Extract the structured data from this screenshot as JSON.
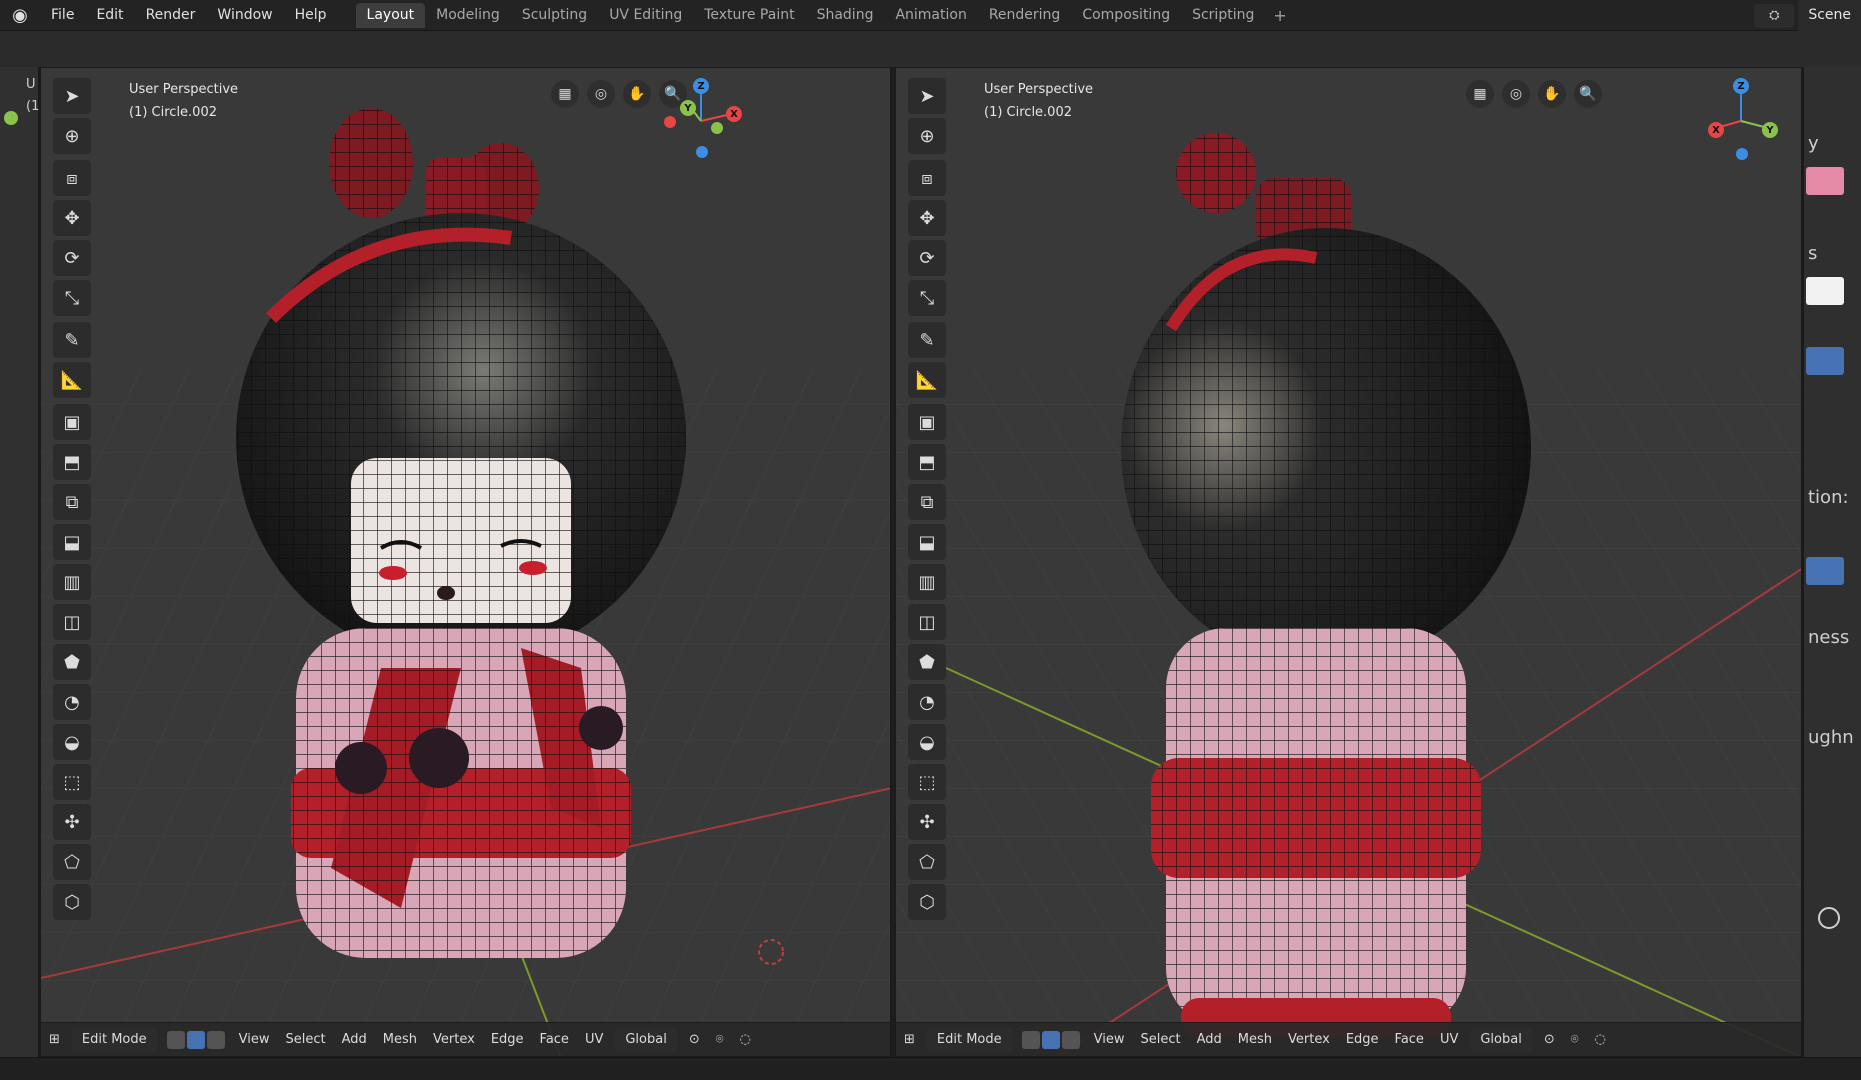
{
  "topbar": {
    "menus": [
      "File",
      "Edit",
      "Render",
      "Window",
      "Help"
    ],
    "workspaces": [
      "Layout",
      "Modeling",
      "Sculpting",
      "UV Editing",
      "Texture Paint",
      "Shading",
      "Animation",
      "Rendering",
      "Compositing",
      "Scripting"
    ],
    "active_workspace": "Layout",
    "add_label": "+",
    "scene_label": "Scene"
  },
  "left_sliver": {
    "text1": "U",
    "text2": "(1"
  },
  "viewport_left": {
    "view_name": "User Perspective",
    "object_name": "(1) Circle.002",
    "gizmo": {
      "z": "Z",
      "y": "Y",
      "x": "X"
    }
  },
  "viewport_right": {
    "view_name": "User Perspective",
    "object_name": "(1) Circle.002",
    "gizmo": {
      "z": "Z",
      "y": "Y",
      "x": "X"
    }
  },
  "bottom_header": {
    "mode": "Edit Mode",
    "menus": [
      "View",
      "Select",
      "Add",
      "Mesh",
      "Vertex",
      "Edge",
      "Face",
      "UV"
    ],
    "orientation": "Global"
  },
  "right_panel": {
    "labels": [
      "y",
      "s",
      "tion:",
      "ness",
      "ughn"
    ]
  },
  "colors": {
    "accent": "#4772b3",
    "axis_x": "#e84545",
    "axis_y": "#8bc34a",
    "axis_z": "#3a8ee6",
    "hair": "#1c1c1c",
    "kimono_pink": "#d9a6b8",
    "kimono_red": "#b3202a"
  }
}
